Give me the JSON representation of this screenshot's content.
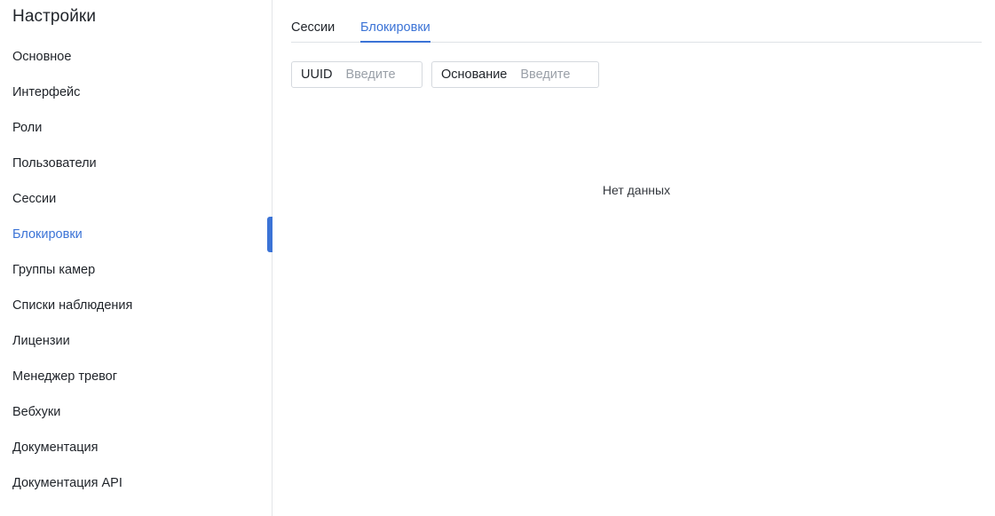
{
  "sidebar": {
    "title": "Настройки",
    "items": [
      {
        "label": "Основное"
      },
      {
        "label": "Интерфейс"
      },
      {
        "label": "Роли"
      },
      {
        "label": "Пользователи"
      },
      {
        "label": "Сессии"
      },
      {
        "label": "Блокировки"
      },
      {
        "label": "Группы камер"
      },
      {
        "label": "Списки наблюдения"
      },
      {
        "label": "Лицензии"
      },
      {
        "label": "Менеджер тревог"
      },
      {
        "label": "Вебхуки"
      },
      {
        "label": "Документация"
      },
      {
        "label": "Документация API"
      }
    ],
    "active_index": 5
  },
  "tabs": [
    {
      "label": "Сессии"
    },
    {
      "label": "Блокировки"
    }
  ],
  "active_tab": 1,
  "filters": {
    "uuid": {
      "label": "UUID",
      "placeholder": "Введите",
      "value": ""
    },
    "reason": {
      "label": "Основание",
      "placeholder": "Введите",
      "value": ""
    }
  },
  "empty_state": "Нет данных",
  "colors": {
    "accent": "#3b73d6",
    "text": "#1f2329",
    "placeholder": "#9aa0a8",
    "border": "#d5d9de"
  }
}
